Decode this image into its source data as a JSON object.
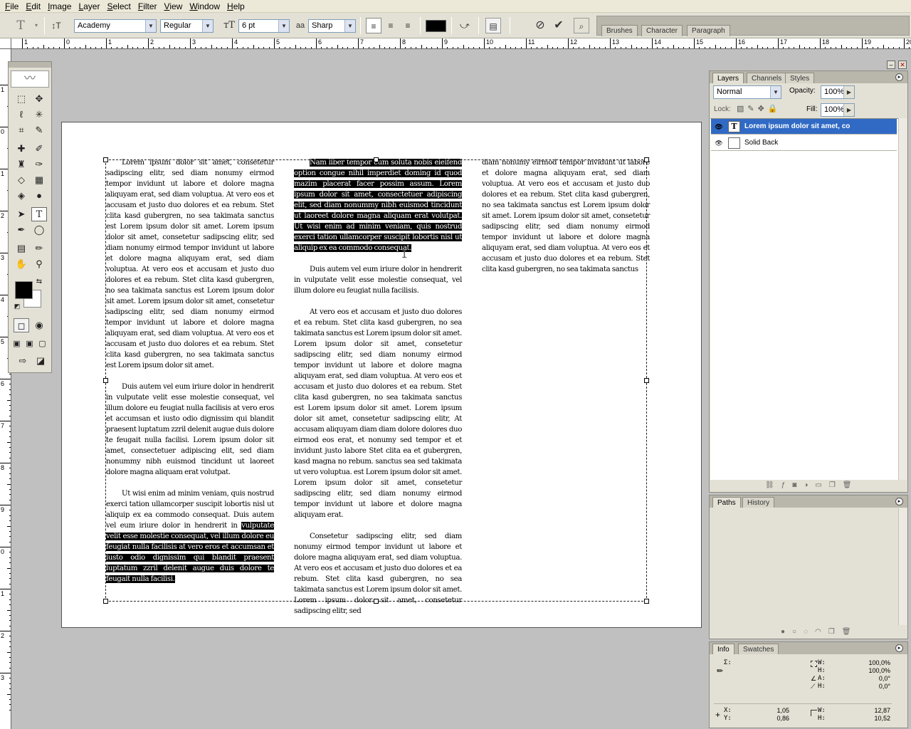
{
  "menu": [
    "File",
    "Edit",
    "Image",
    "Layer",
    "Select",
    "Filter",
    "View",
    "Window",
    "Help"
  ],
  "options": {
    "font_family": "Academy",
    "font_style": "Regular",
    "font_size": "6 pt",
    "aa_label": "aa",
    "antialias": "Sharp"
  },
  "palette_well": {
    "tabs": [
      "Brushes",
      "Character",
      "Paragraph"
    ]
  },
  "rulers": {
    "h_labels": [
      "1",
      "0",
      "1",
      "2",
      "3",
      "4",
      "5",
      "6",
      "7",
      "8",
      "9",
      "10",
      "11",
      "12",
      "13",
      "14",
      "15",
      "16",
      "17",
      "18",
      "19",
      "20"
    ],
    "v_labels": [
      "1",
      "0",
      "1",
      "2",
      "3",
      "4",
      "5",
      "6",
      "7",
      "8",
      "9",
      "0",
      "1",
      "2",
      "3"
    ]
  },
  "document": {
    "col1": {
      "p1_indent": "Lorem ipsum dolor sit amet, consetetur sadipscing elitr, sed diam nonumy eirmod tempor invidunt ut labore et dolore magna aliquyam erat, sed diam voluptua. At vero eos et accusam et justo duo dolores et ea rebum. Stet clita kasd gubergren, no sea takimata sanctus est Lorem ipsum dolor sit amet. Lorem ipsum dolor sit amet, consetetur sadipscing elitr, sed diam nonumy eirmod tempor invidunt ut labore et dolore magna aliquyam erat, sed diam voluptua. At vero eos et accusam et justo duo dolores et ea rebum. Stet clita kasd gubergren, no sea takimata sanctus est Lorem ipsum dolor sit amet. Lorem ipsum dolor sit amet, consetetur sadipscing elitr, sed diam nonumy eirmod tempor invidunt ut labore et dolore magna aliquyam erat, sed diam voluptua. At vero eos et accusam et justo duo dolores et ea rebum. Stet clita kasd gubergren, no sea takimata sanctus est Lorem ipsum dolor sit amet.",
      "p2": "Duis autem vel eum iriure dolor in hendrerit in vulputate velit esse molestie consequat, vel illum dolore eu feugiat nulla facilisis at vero eros et accumsan et iusto odio dignissim qui blandit praesent luptatum zzril delenit augue duis dolore te feugait nulla facilisi. Lorem ipsum dolor sit amet, consectetuer adipiscing elit, sed diam nonummy nibh euismod tincidunt ut laoreet dolore magna aliquam erat volutpat.",
      "p3_plain": "Ut wisi enim ad minim veniam, quis nostrud exerci tation ullamcorper suscipit lobortis nisl ut aliquip ex ea commodo consequat. Duis autem vel eum iriure dolor in hendrerit in ",
      "p3_selected": "vulputate velit esse molestie consequat, vel illum dolore eu feugiat nulla facilisis at vero eros et accumsan et iusto odio dignissim qui blandit praesent luptatum zzril delenit augue duis dolore te feugait nulla facilisi."
    },
    "col2": {
      "p1_selected": "Nam liber tempor cum soluta nobis eleifend option congue nihil imperdiet doming id quod mazim placerat facer possim assum. Lorem ipsum dolor sit amet, consectetuer adipiscing elit, sed diam nonummy nibh euismod tincidunt ut laoreet dolore magna aliquam erat volutpat. Ut wisi enim ad minim veniam, quis nostrud exerci tation ullamcorper suscipit lobortis nisl ut aliquip ex ea commodo consequat.",
      "p2": "Duis autem vel eum iriure dolor in hendrerit in vulputate velit esse molestie consequat, vel illum dolore eu feugiat nulla facilisis.",
      "p3": "At vero eos et accusam et justo duo dolores et ea rebum. Stet clita kasd gubergren, no sea takimata sanctus est Lorem ipsum dolor sit amet. Lorem ipsum dolor sit amet, consetetur sadipscing elitr, sed diam nonumy eirmod tempor invidunt ut labore et dolore magna aliquyam erat, sed diam voluptua. At vero eos et accusam et justo duo dolores et ea rebum. Stet clita kasd gubergren, no sea takimata sanctus est Lorem ipsum dolor sit amet. Lorem ipsum dolor sit amet, consetetur sadipscing elitr, At accusam aliquyam diam diam dolore dolores duo eirmod eos erat, et nonumy sed tempor et et invidunt justo labore Stet clita ea et gubergren, kasd magna no rebum. sanctus sea sed takimata ut vero voluptua. est Lorem ipsum dolor sit amet. Lorem ipsum dolor sit amet, consetetur sadipscing elitr, sed diam nonumy eirmod tempor invidunt ut labore et dolore magna aliquyam erat.",
      "p4": "Consetetur sadipscing elitr, sed diam nonumy eirmod tempor invidunt ut labore et dolore magna aliquyam erat, sed diam voluptua. At vero eos et accusam et justo duo dolores et ea rebum. Stet clita kasd gubergren, no sea takimata sanctus est Lorem ipsum dolor sit amet. Lorem ipsum dolor sit amet, consetetur sadipscing elitr, sed"
    },
    "col3": {
      "p1": "diam nonumy eirmod tempor invidunt ut labore et dolore magna aliquyam erat, sed diam voluptua. At vero eos et accusam et justo duo dolores et ea rebum. Stet clita kasd gubergren, no sea takimata sanctus est Lorem ipsum dolor sit amet. Lorem ipsum dolor sit amet, consetetur sadipscing elitr, sed diam nonumy eirmod tempor invidunt ut labore et dolore magna aliquyam erat, sed diam voluptua. At vero eos et accusam et justo duo dolores et ea rebum. Stet clita kasd gubergren, no sea takimata sanctus"
    }
  },
  "layers_panel": {
    "tabs": [
      "Layers",
      "Channels",
      "Styles"
    ],
    "blend_mode": "Normal",
    "opacity_label": "Opacity:",
    "opacity": "100%",
    "lock_label": "Lock:",
    "fill_label": "Fill:",
    "fill": "100%",
    "layers": [
      {
        "name": "Lorem ipsum dolor sit amet, co",
        "thumb": "T",
        "selected": true
      },
      {
        "name": "Solid Back",
        "thumb": "",
        "selected": false
      }
    ]
  },
  "paths_panel": {
    "tabs": [
      "Paths",
      "History"
    ]
  },
  "info_panel": {
    "tabs": [
      "Info",
      "Swatches"
    ],
    "sigma_label": "Σ:",
    "w_label": "W:",
    "h_label": "H:",
    "w_pct": "100,0%",
    "h_pct": "100,0%",
    "angle_label": "A:",
    "angle": "0,0°",
    "hskew_label": "H:",
    "hskew": "0,0°",
    "x_label": "X:",
    "y_label": "Y:",
    "x": "1,05",
    "y": "0,86",
    "w2_label": "W:",
    "h2_label": "H:",
    "w": "12,87",
    "h": "10,52"
  },
  "colors": {
    "selection": "#316ac5",
    "ui_bg": "#e3e1d5",
    "workspace": "#c0c0c0"
  }
}
